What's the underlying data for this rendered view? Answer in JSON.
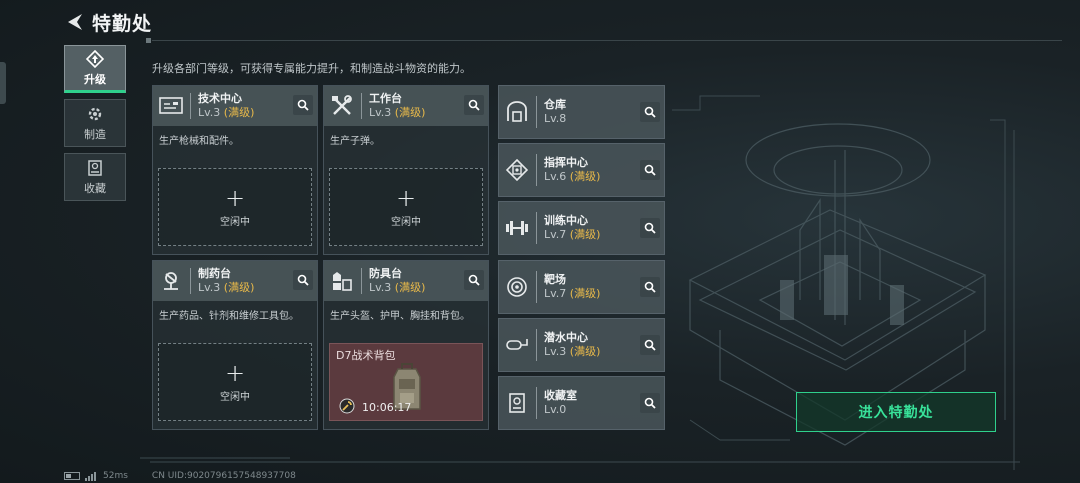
{
  "header": {
    "title": "特勤处"
  },
  "nav": [
    {
      "label": "升级",
      "icon": "upgrade-icon",
      "active": true
    },
    {
      "label": "制造",
      "icon": "gear-icon",
      "active": false
    },
    {
      "label": "收藏",
      "icon": "collection-icon",
      "active": false
    }
  ],
  "description": "升级各部门等级，可获得专属能力提升，和制造战斗物资的能力。",
  "facilities": [
    {
      "name": "技术中心",
      "level": "Lv.3",
      "max": "(满级)",
      "desc": "生产枪械和配件。",
      "slot": {
        "state": "idle",
        "plus": "+",
        "text": "空闲中"
      },
      "icon": "tech-center-icon"
    },
    {
      "name": "工作台",
      "level": "Lv.3",
      "max": "(满级)",
      "desc": "生产子弹。",
      "slot": {
        "state": "idle",
        "plus": "+",
        "text": "空闲中"
      },
      "icon": "workbench-icon"
    },
    {
      "name": "制药台",
      "level": "Lv.3",
      "max": "(满级)",
      "desc": "生产药品、针剂和维修工具包。",
      "slot": {
        "state": "idle",
        "plus": "+",
        "text": "空闲中"
      },
      "icon": "pharmacy-icon"
    },
    {
      "name": "防具台",
      "level": "Lv.3",
      "max": "(满级)",
      "desc": "生产头盔、护甲、胸挂和背包。",
      "slot": {
        "state": "busy",
        "item": "D7战术背包",
        "timer": "10:06:17"
      },
      "icon": "armor-bench-icon"
    }
  ],
  "buildings": [
    {
      "name": "仓库",
      "level": "Lv.8",
      "max": "",
      "icon": "warehouse-icon"
    },
    {
      "name": "指挥中心",
      "level": "Lv.6",
      "max": "(满级)",
      "icon": "command-center-icon"
    },
    {
      "name": "训练中心",
      "level": "Lv.7",
      "max": "(满级)",
      "icon": "dumbbell-icon"
    },
    {
      "name": "靶场",
      "level": "Lv.7",
      "max": "(满级)",
      "icon": "target-icon"
    },
    {
      "name": "潜水中心",
      "level": "Lv.3",
      "max": "(满级)",
      "icon": "diving-icon"
    },
    {
      "name": "收藏室",
      "level": "Lv.0",
      "max": "",
      "icon": "collection-room-icon"
    }
  ],
  "enter_button": "进入特勤处",
  "status": {
    "ping": "52ms",
    "uid": "CN UID:9020796157548937708"
  },
  "colors": {
    "accent_green": "#2fd08c",
    "maxed_gold": "#e8b94a",
    "busy_slot": "#5b3a3e"
  }
}
